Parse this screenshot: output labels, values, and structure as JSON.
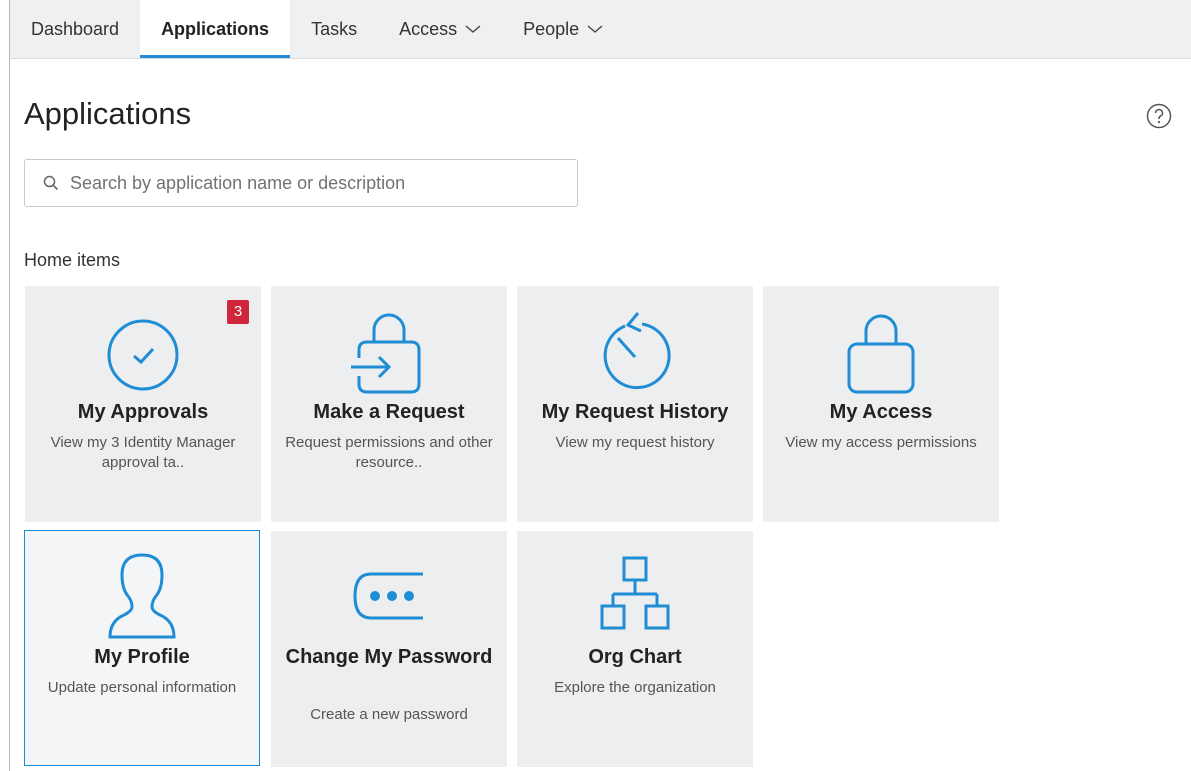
{
  "colors": {
    "accent": "#1f8dd6",
    "badge": "#d0263b",
    "tile_bg": "#eceeef"
  },
  "nav": {
    "tabs": [
      {
        "label": "Dashboard",
        "active": false,
        "dropdown": false
      },
      {
        "label": "Applications",
        "active": true,
        "dropdown": false
      },
      {
        "label": "Tasks",
        "active": false,
        "dropdown": false
      },
      {
        "label": "Access",
        "active": false,
        "dropdown": true
      },
      {
        "label": "People",
        "active": false,
        "dropdown": true
      }
    ]
  },
  "page": {
    "title": "Applications",
    "help_icon": "help-circle-icon"
  },
  "search": {
    "placeholder": "Search by application name or description",
    "value": ""
  },
  "home_items": {
    "label": "Home items",
    "tiles": [
      {
        "name": "My Approvals",
        "description": "View my 3 Identity Manager approval ta..",
        "badge": "3",
        "icon": "check-circle-icon"
      },
      {
        "name": "Make a Request",
        "description": "Request permissions and other resource..",
        "icon": "lock-enter-icon"
      },
      {
        "name": "My Request History",
        "description": "View my request history",
        "icon": "history-icon"
      },
      {
        "name": "My Access",
        "description": "View my access permissions",
        "icon": "lock-icon"
      },
      {
        "name": "My Profile",
        "description": "Update personal information",
        "icon": "user-icon",
        "selected": true
      },
      {
        "name": "Change My Password",
        "description": "Create a new password",
        "icon": "password-icon"
      },
      {
        "name": "Org Chart",
        "description": "Explore the organization",
        "icon": "org-chart-icon"
      }
    ]
  }
}
